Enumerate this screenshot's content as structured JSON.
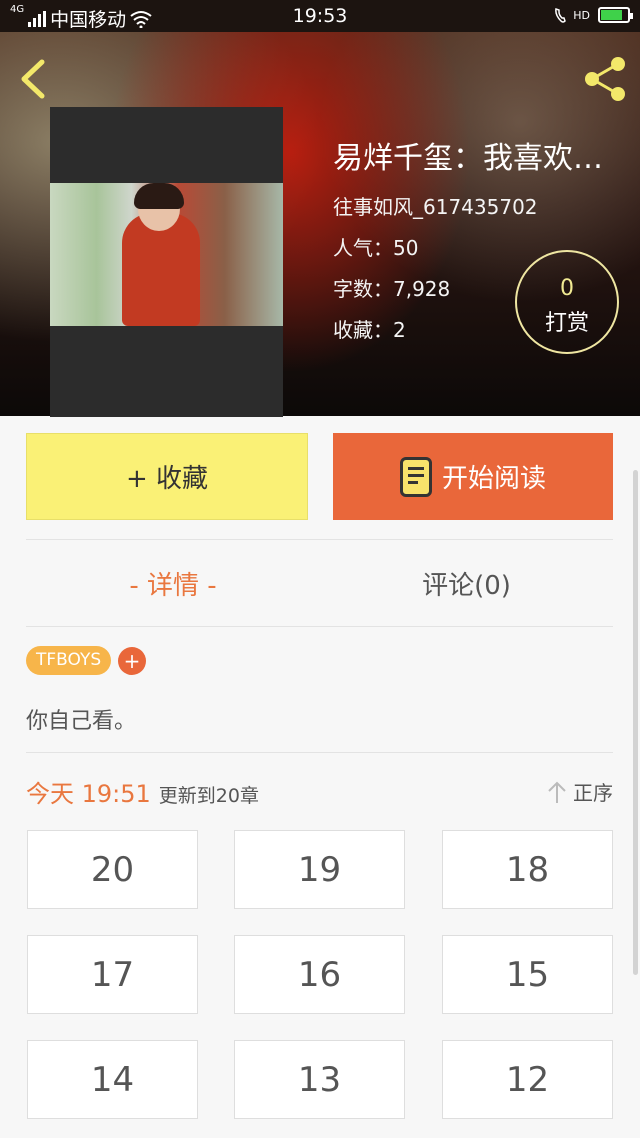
{
  "status_bar": {
    "network": "4G",
    "carrier": "中国移动",
    "time": "19:53",
    "hd_label": "HD",
    "battery_level": 0.8,
    "battery_color": "#3fd14a"
  },
  "header": {
    "back_icon": "chevron-left-icon",
    "share_icon": "share-icon",
    "icon_color": "#f3e86a"
  },
  "book": {
    "title": "易烊千玺：我喜欢你...",
    "author": "往事如风_617435702",
    "popularity": "人气：50",
    "word_count": "字数：7,928",
    "favorites": "收藏：2"
  },
  "tip": {
    "count": "0",
    "label": "打赏"
  },
  "actions": {
    "collect_label": "+ 收藏",
    "read_label": "开始阅读",
    "collect_color": "#faf176",
    "read_color": "#e9673a"
  },
  "tabs": [
    {
      "label": "- 详情 -",
      "active": true
    },
    {
      "label": "评论(0)",
      "active": false
    }
  ],
  "tags": [
    {
      "label": "TFBOYS"
    }
  ],
  "tag_add_label": "+",
  "description": "你自己看。",
  "update": {
    "when": "今天 19:51",
    "text": "更新到20章"
  },
  "sort_label": "正序",
  "chapters": [
    "20",
    "19",
    "18",
    "17",
    "16",
    "15",
    "14",
    "13",
    "12"
  ]
}
